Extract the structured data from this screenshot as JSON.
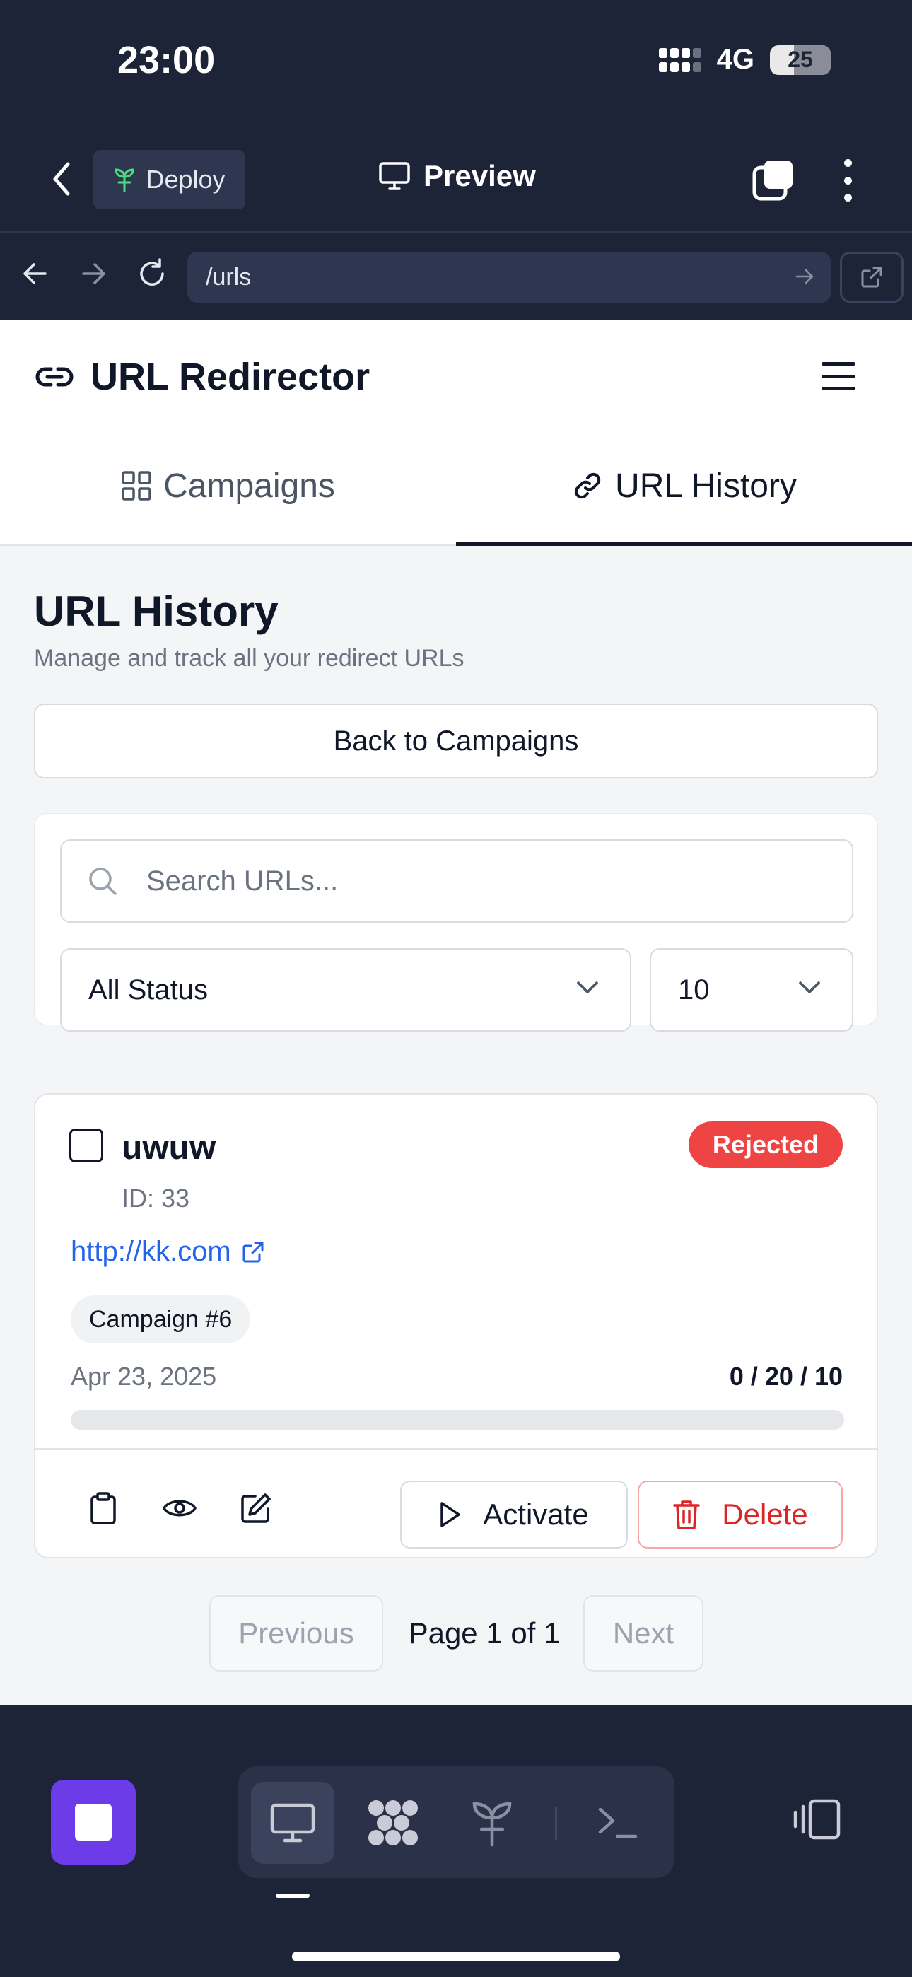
{
  "status_bar": {
    "time": "23:00",
    "network": "4G",
    "battery": "25"
  },
  "top_nav": {
    "deploy_label": "Deploy",
    "preview_label": "Preview"
  },
  "browser": {
    "url": "/urls"
  },
  "app": {
    "title": "URL Redirector",
    "tabs": [
      {
        "label": "Campaigns",
        "active": false
      },
      {
        "label": "URL History",
        "active": true
      }
    ]
  },
  "page": {
    "title": "URL History",
    "subtitle": "Manage and track all your redirect URLs",
    "back_button": "Back to Campaigns",
    "search_placeholder": "Search URLs...",
    "status_filter": "All Status",
    "page_size": "10"
  },
  "urls": [
    {
      "name": "uwuw",
      "id_text": "ID: 33",
      "status": "Rejected",
      "status_color": "#ef4444",
      "link": "http://kk.com",
      "campaign": "Campaign #6",
      "date": "Apr 23, 2025",
      "stats": "0 / 20 / 10",
      "progress": 0,
      "activate_label": "Activate",
      "delete_label": "Delete"
    }
  ],
  "pagination": {
    "previous": "Previous",
    "info": "Page 1 of 1",
    "next": "Next"
  },
  "colors": {
    "accent": "#2563eb",
    "danger": "#dc2626",
    "dock_primary": "#6c3ce9",
    "dark_bg": "#1e2438"
  },
  "icons": [
    "link-icon",
    "grid-icon",
    "search-icon",
    "chevron-down-icon",
    "external-link-icon",
    "clipboard-icon",
    "eye-icon",
    "edit-icon",
    "play-icon",
    "trash-icon",
    "monitor-icon",
    "sprout-icon",
    "terminal-icon"
  ]
}
